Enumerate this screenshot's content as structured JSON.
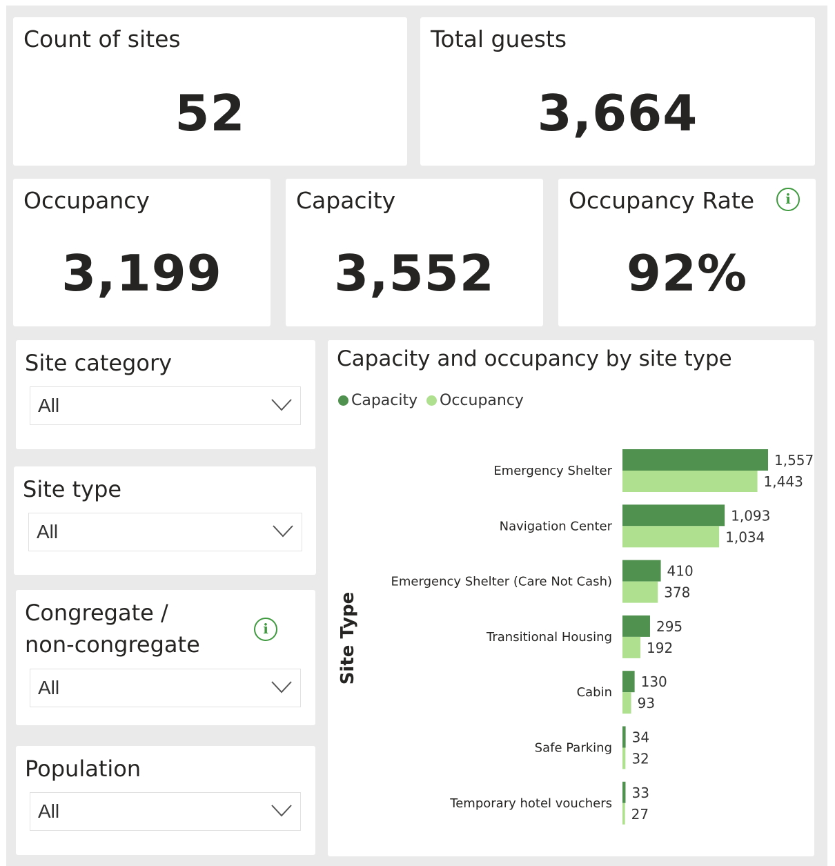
{
  "kpis": {
    "count_of_sites": {
      "title": "Count of sites",
      "value": "52"
    },
    "total_guests": {
      "title": "Total guests",
      "value": "3,664"
    },
    "occupancy": {
      "title": "Occupancy",
      "value": "3,199"
    },
    "capacity": {
      "title": "Capacity",
      "value": "3,552"
    },
    "occupancy_rate": {
      "title": "Occupancy Rate",
      "value": "92%",
      "info_icon": "info-icon"
    }
  },
  "slicers": {
    "site_category": {
      "title": "Site category",
      "selected": "All"
    },
    "site_type": {
      "title": "Site type",
      "selected": "All"
    },
    "congregate": {
      "title_line1": "Congregate /",
      "title_line2": "non-congregate",
      "selected": "All",
      "info_icon": "info-icon"
    },
    "population": {
      "title": "Population",
      "selected": "All"
    }
  },
  "chart_data": {
    "type": "bar",
    "orientation": "horizontal",
    "title": "Capacity and occupancy by site type",
    "ylabel": "Site Type",
    "xlabel": "",
    "legend_position": "top-left",
    "categories": [
      "Emergency Shelter",
      "Navigation Center",
      "Emergency Shelter (Care Not Cash)",
      "Transitional Housing",
      "Cabin",
      "Safe Parking",
      "Temporary hotel vouchers"
    ],
    "series": [
      {
        "name": "Capacity",
        "color": "#519150",
        "values": [
          1557,
          1093,
          410,
          295,
          130,
          34,
          33
        ],
        "labels": [
          "1,557",
          "1,093",
          "410",
          "295",
          "130",
          "34",
          "33"
        ]
      },
      {
        "name": "Occupancy",
        "color": "#afe08f",
        "values": [
          1443,
          1034,
          378,
          192,
          93,
          32,
          27
        ],
        "labels": [
          "1,443",
          "1,034",
          "378",
          "192",
          "93",
          "32",
          "27"
        ]
      }
    ],
    "grid": false
  },
  "colors": {
    "accent": "#3f9a3f",
    "capacity_bar": "#519150",
    "occupancy_bar": "#afe08f",
    "background": "#eaeaea"
  }
}
